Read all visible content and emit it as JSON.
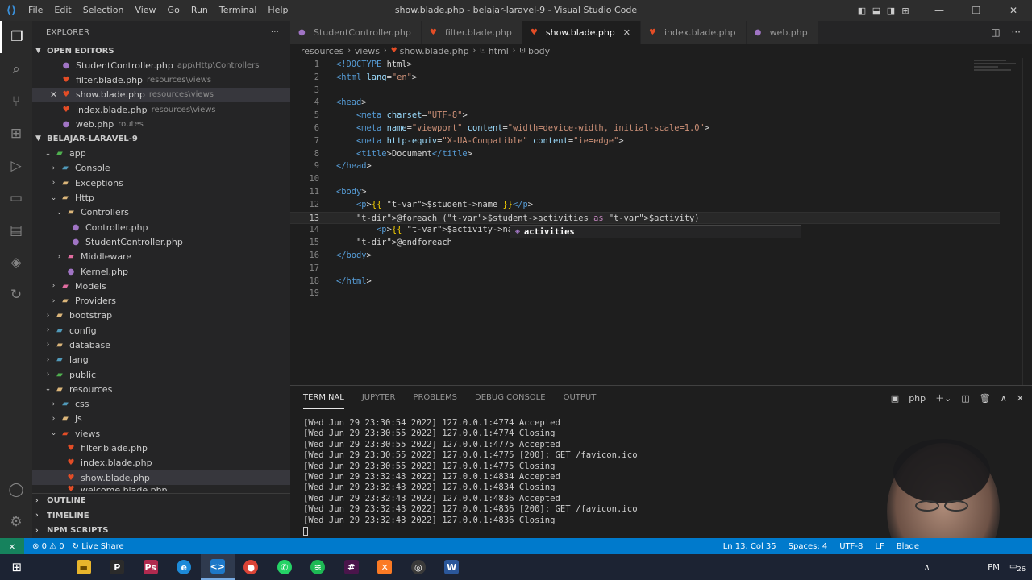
{
  "window": {
    "title": "show.blade.php - belajar-laravel-9 - Visual Studio Code",
    "menu": [
      "File",
      "Edit",
      "Selection",
      "View",
      "Go",
      "Run",
      "Terminal",
      "Help"
    ]
  },
  "sidebar": {
    "header": "EXPLORER",
    "open_editors": {
      "title": "OPEN EDITORS",
      "items": [
        {
          "name": "StudentController.php",
          "path": "app\\Http\\Controllers"
        },
        {
          "name": "filter.blade.php",
          "path": "resources\\views"
        },
        {
          "name": "show.blade.php",
          "path": "resources\\views"
        },
        {
          "name": "index.blade.php",
          "path": "resources\\views"
        },
        {
          "name": "web.php",
          "path": "routes"
        }
      ]
    },
    "project": {
      "title": "BELAJAR-LARAVEL-9",
      "tree": [
        {
          "label": "app"
        },
        {
          "label": "Console"
        },
        {
          "label": "Exceptions"
        },
        {
          "label": "Http"
        },
        {
          "label": "Controllers"
        },
        {
          "label": "Controller.php"
        },
        {
          "label": "StudentController.php"
        },
        {
          "label": "Middleware"
        },
        {
          "label": "Kernel.php"
        },
        {
          "label": "Models"
        },
        {
          "label": "Providers"
        },
        {
          "label": "bootstrap"
        },
        {
          "label": "config"
        },
        {
          "label": "database"
        },
        {
          "label": "lang"
        },
        {
          "label": "public"
        },
        {
          "label": "resources"
        },
        {
          "label": "css"
        },
        {
          "label": "js"
        },
        {
          "label": "views"
        },
        {
          "label": "filter.blade.php"
        },
        {
          "label": "index.blade.php"
        },
        {
          "label": "show.blade.php"
        },
        {
          "label": "welcome.blade.php"
        }
      ]
    },
    "bottom": [
      "OUTLINE",
      "TIMELINE",
      "NPM SCRIPTS"
    ]
  },
  "tabs": [
    {
      "label": "StudentController.php"
    },
    {
      "label": "filter.blade.php"
    },
    {
      "label": "show.blade.php"
    },
    {
      "label": "index.blade.php"
    },
    {
      "label": "web.php"
    }
  ],
  "breadcrumb": [
    "resources",
    "views",
    "show.blade.php",
    "html",
    "body"
  ],
  "editor": {
    "lines": [
      {
        "n": "1",
        "t": "<!DOCTYPE html>"
      },
      {
        "n": "2",
        "t": "<html lang=\"en\">"
      },
      {
        "n": "3",
        "t": ""
      },
      {
        "n": "4",
        "t": "<head>"
      },
      {
        "n": "5",
        "t": "    <meta charset=\"UTF-8\">"
      },
      {
        "n": "6",
        "t": "    <meta name=\"viewport\" content=\"width=device-width, initial-scale=1.0\">"
      },
      {
        "n": "7",
        "t": "    <meta http-equiv=\"X-UA-Compatible\" content=\"ie=edge\">"
      },
      {
        "n": "8",
        "t": "    <title>Document</title>"
      },
      {
        "n": "9",
        "t": "</head>"
      },
      {
        "n": "10",
        "t": ""
      },
      {
        "n": "11",
        "t": "<body>"
      },
      {
        "n": "12",
        "t": "    <p>{{ $student->name }}</p>"
      },
      {
        "n": "13",
        "t": "    @foreach ($student->activities as $activity)"
      },
      {
        "n": "14",
        "t": "        <p>{{ $activity->name }}</p>"
      },
      {
        "n": "15",
        "t": "    @endforeach"
      },
      {
        "n": "16",
        "t": "</body>"
      },
      {
        "n": "17",
        "t": ""
      },
      {
        "n": "18",
        "t": "</html>"
      },
      {
        "n": "19",
        "t": ""
      }
    ],
    "suggestion": "activities"
  },
  "panel": {
    "tabs": [
      "TERMINAL",
      "JUPYTER",
      "PROBLEMS",
      "DEBUG CONSOLE",
      "OUTPUT"
    ],
    "shell": "php",
    "terminal_lines": [
      "[Wed Jun 29 23:30:54 2022] 127.0.0.1:4774 Accepted",
      "[Wed Jun 29 23:30:55 2022] 127.0.0.1:4774 Closing",
      "[Wed Jun 29 23:30:55 2022] 127.0.0.1:4775 Accepted",
      "[Wed Jun 29 23:30:55 2022] 127.0.0.1:4775 [200]: GET /favicon.ico",
      "[Wed Jun 29 23:30:55 2022] 127.0.0.1:4775 Closing",
      "[Wed Jun 29 23:32:43 2022] 127.0.0.1:4834 Accepted",
      "[Wed Jun 29 23:32:43 2022] 127.0.0.1:4834 Closing",
      "[Wed Jun 29 23:32:43 2022] 127.0.0.1:4836 Accepted",
      "[Wed Jun 29 23:32:43 2022] 127.0.0.1:4836 [200]: GET /favicon.ico",
      "[Wed Jun 29 23:32:43 2022] 127.0.0.1:4836 Closing"
    ]
  },
  "statusbar": {
    "problems": "0",
    "warnings": "0",
    "live_share": "Live Share",
    "position": "Ln 13, Col 35",
    "spaces": "Spaces: 4",
    "encoding": "UTF-8",
    "eol": "LF",
    "language": "Blade"
  },
  "taskbar": {
    "clock_time": "PM",
    "notifications": "26"
  },
  "colors": {
    "statusbar": "#007acc",
    "editor_bg": "#1e1e1e",
    "sidebar_bg": "#252526"
  }
}
